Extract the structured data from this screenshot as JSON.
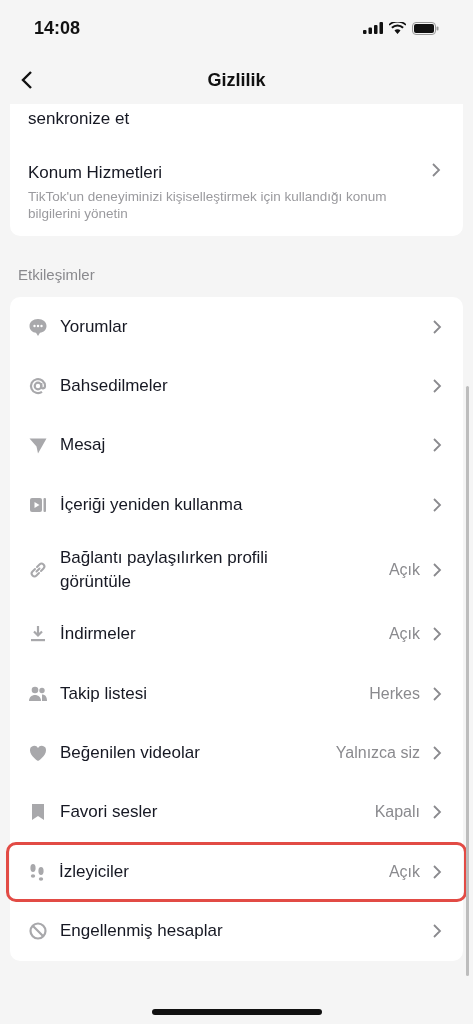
{
  "status_bar": {
    "time": "14:08"
  },
  "header": {
    "title": "Gizlilik"
  },
  "top_card": {
    "partial_text": "senkronize et",
    "item": {
      "label": "Konum Hizmetleri",
      "description": "TikTok'un deneyiminizi kişiselleştirmek için kullandığı konum bilgilerini yönetin"
    }
  },
  "section": {
    "title": "Etkileşimler",
    "items": [
      {
        "label": "Yorumlar",
        "highlighted": false
      },
      {
        "label": "Bahsedilmeler",
        "highlighted": false
      },
      {
        "label": "Mesaj",
        "highlighted": false
      },
      {
        "label": "İçeriği yeniden kullanma",
        "highlighted": false
      },
      {
        "label": "Bağlantı paylaşılırken profili görüntüle",
        "value": "Açık",
        "highlighted": false
      },
      {
        "label": "İndirmeler",
        "value": "Açık",
        "highlighted": false
      },
      {
        "label": "Takip listesi",
        "value": "Herkes",
        "highlighted": false
      },
      {
        "label": "Beğenilen videolar",
        "value": "Yalnızca siz",
        "highlighted": false
      },
      {
        "label": "Favori sesler",
        "value": "Kapalı",
        "highlighted": false
      },
      {
        "label": "İzleyiciler",
        "value": "Açık",
        "highlighted": true
      },
      {
        "label": "Engellenmiş hesaplar",
        "highlighted": false
      }
    ]
  }
}
